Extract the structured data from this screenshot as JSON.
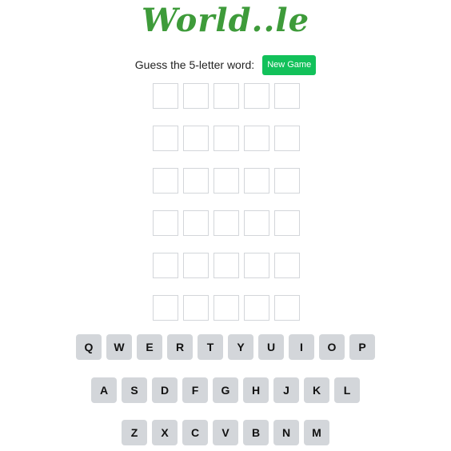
{
  "header": {
    "logo_text": "World..le"
  },
  "prompt": {
    "text": "Guess the 5-letter word:",
    "new_game_label": "New Game"
  },
  "colors": {
    "logo": "#3e9b3a",
    "new_game_button": "#12c15a",
    "key_background": "#d3d6da",
    "tile_border": "#d3d6da"
  },
  "board": {
    "rows": 6,
    "columns": 5
  },
  "keyboard": {
    "row1": [
      "Q",
      "W",
      "E",
      "R",
      "T",
      "Y",
      "U",
      "I",
      "O",
      "P"
    ],
    "row2": [
      "A",
      "S",
      "D",
      "F",
      "G",
      "H",
      "J",
      "K",
      "L"
    ],
    "row3": [
      "Z",
      "X",
      "C",
      "V",
      "B",
      "N",
      "M"
    ]
  }
}
